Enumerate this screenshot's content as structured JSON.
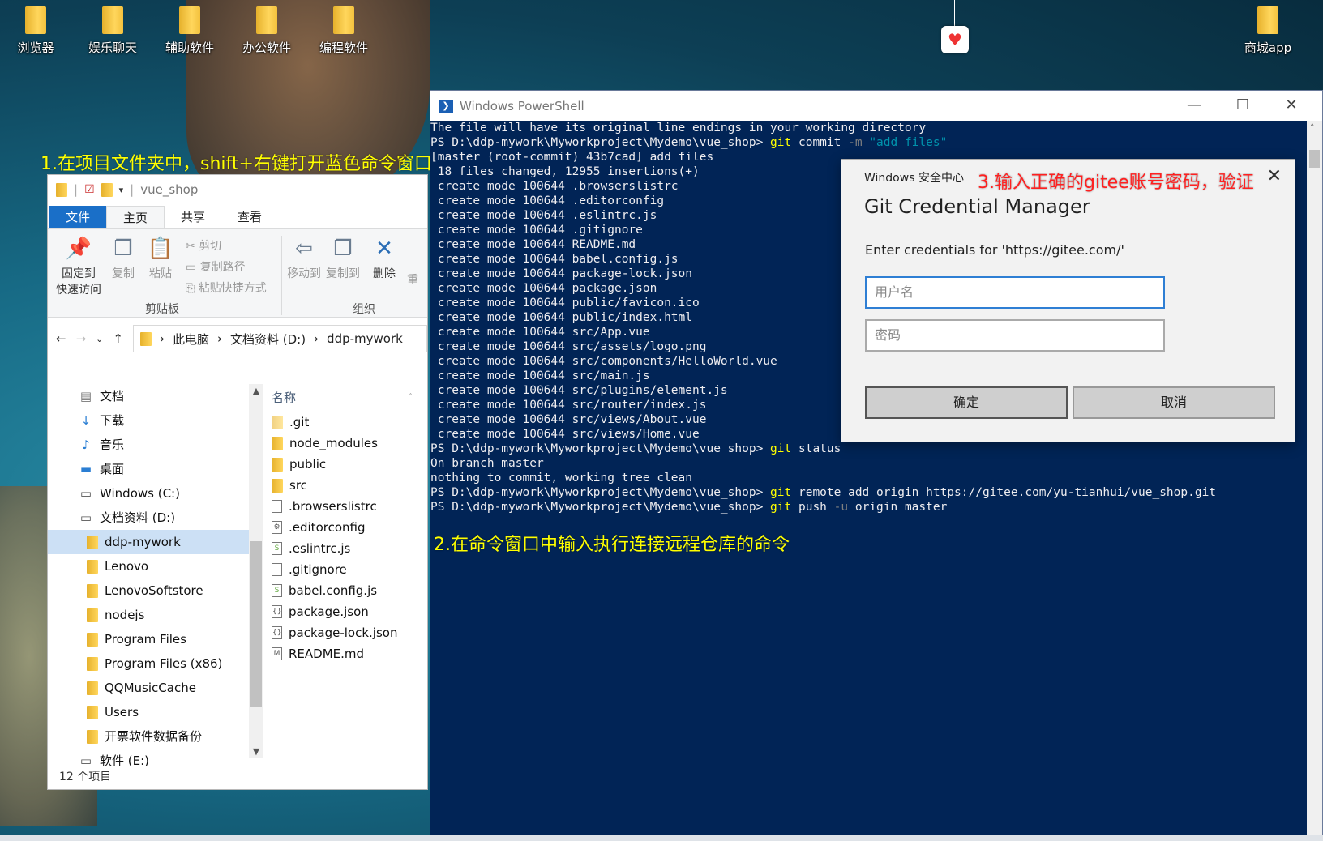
{
  "desktop": {
    "icons": [
      "浏览器",
      "娱乐聊天",
      "辅助软件",
      "办公软件",
      "编程软件",
      "商城app"
    ]
  },
  "annotations": {
    "step1": "1.在项目文件夹中，shift+右键打开蓝色命令窗口",
    "step2": "2.在命令窗口中输入执行连接远程仓库的命令",
    "step3": "3.输入正确的gitee账号密码，验证"
  },
  "explorer": {
    "title": "vue_shop",
    "tabs": [
      "文件",
      "主页",
      "共享",
      "查看"
    ],
    "ribbon": {
      "pin_line1": "固定到",
      "pin_line2": "快速访问",
      "copy": "复制",
      "paste": "粘贴",
      "cut": "剪切",
      "copy_path": "复制路径",
      "paste_shortcut": "粘贴快捷方式",
      "clipboard_group": "剪贴板",
      "move_to": "移动到",
      "copy_to": "复制到",
      "delete": "删除",
      "rename_partial": "重",
      "organize_group": "组织"
    },
    "breadcrumb": [
      "此电脑",
      "文档资料 (D:)",
      "ddp-mywork"
    ],
    "nav": [
      "文档",
      "下载",
      "音乐",
      "桌面",
      "Windows (C:)",
      "文档资料 (D:)",
      "ddp-mywork",
      "Lenovo",
      "LenovoSoftstore",
      "nodejs",
      "Program Files",
      "Program Files (x86)",
      "QQMusicCache",
      "Users",
      "开票软件数据备份",
      "软件 (E:)"
    ],
    "column_name": "名称",
    "files": [
      ".git",
      "node_modules",
      "public",
      "src",
      ".browserslistrc",
      ".editorconfig",
      ".eslintrc.js",
      ".gitignore",
      "babel.config.js",
      "package.json",
      "package-lock.json",
      "README.md"
    ],
    "status": "12 个项目"
  },
  "powershell": {
    "title": "Windows PowerShell",
    "line0": "The file will have its original line endings in your working directory",
    "prompt": "PS D:\\ddp-mywork\\Myworkproject\\Mydemo\\vue_shop>",
    "commit_cmd": "git",
    "commit_sub": "commit",
    "commit_flag": "-m",
    "commit_msg": "\"add files\"",
    "out_lines": [
      "[master (root-commit) 43b7cad] add files",
      " 18 files changed, 12955 insertions(+)",
      " create mode 100644 .browserslistrc",
      " create mode 100644 .editorconfig",
      " create mode 100644 .eslintrc.js",
      " create mode 100644 .gitignore",
      " create mode 100644 README.md",
      " create mode 100644 babel.config.js",
      " create mode 100644 package-lock.json",
      " create mode 100644 package.json",
      " create mode 100644 public/favicon.ico",
      " create mode 100644 public/index.html",
      " create mode 100644 src/App.vue",
      " create mode 100644 src/assets/logo.png",
      " create mode 100644 src/components/HelloWorld.vue",
      " create mode 100644 src/main.js",
      " create mode 100644 src/plugins/element.js",
      " create mode 100644 src/router/index.js",
      " create mode 100644 src/views/About.vue",
      " create mode 100644 src/views/Home.vue"
    ],
    "status_cmd": "git",
    "status_sub": "status",
    "status_out1": "On branch master",
    "status_out2": "nothing to commit, working tree clean",
    "remote_cmd": "git",
    "remote_rest": "remote add origin https://gitee.com/yu-tianhui/vue_shop.git",
    "push_cmd": "git",
    "push_sub": "push",
    "push_flag": "-u",
    "push_rest": "origin master"
  },
  "credential": {
    "header": "Windows 安全中心",
    "title": "Git Credential Manager",
    "message": "Enter credentials for 'https://gitee.com/'",
    "username_placeholder": "用户名",
    "password_placeholder": "密码",
    "ok": "确定",
    "cancel": "取消"
  }
}
